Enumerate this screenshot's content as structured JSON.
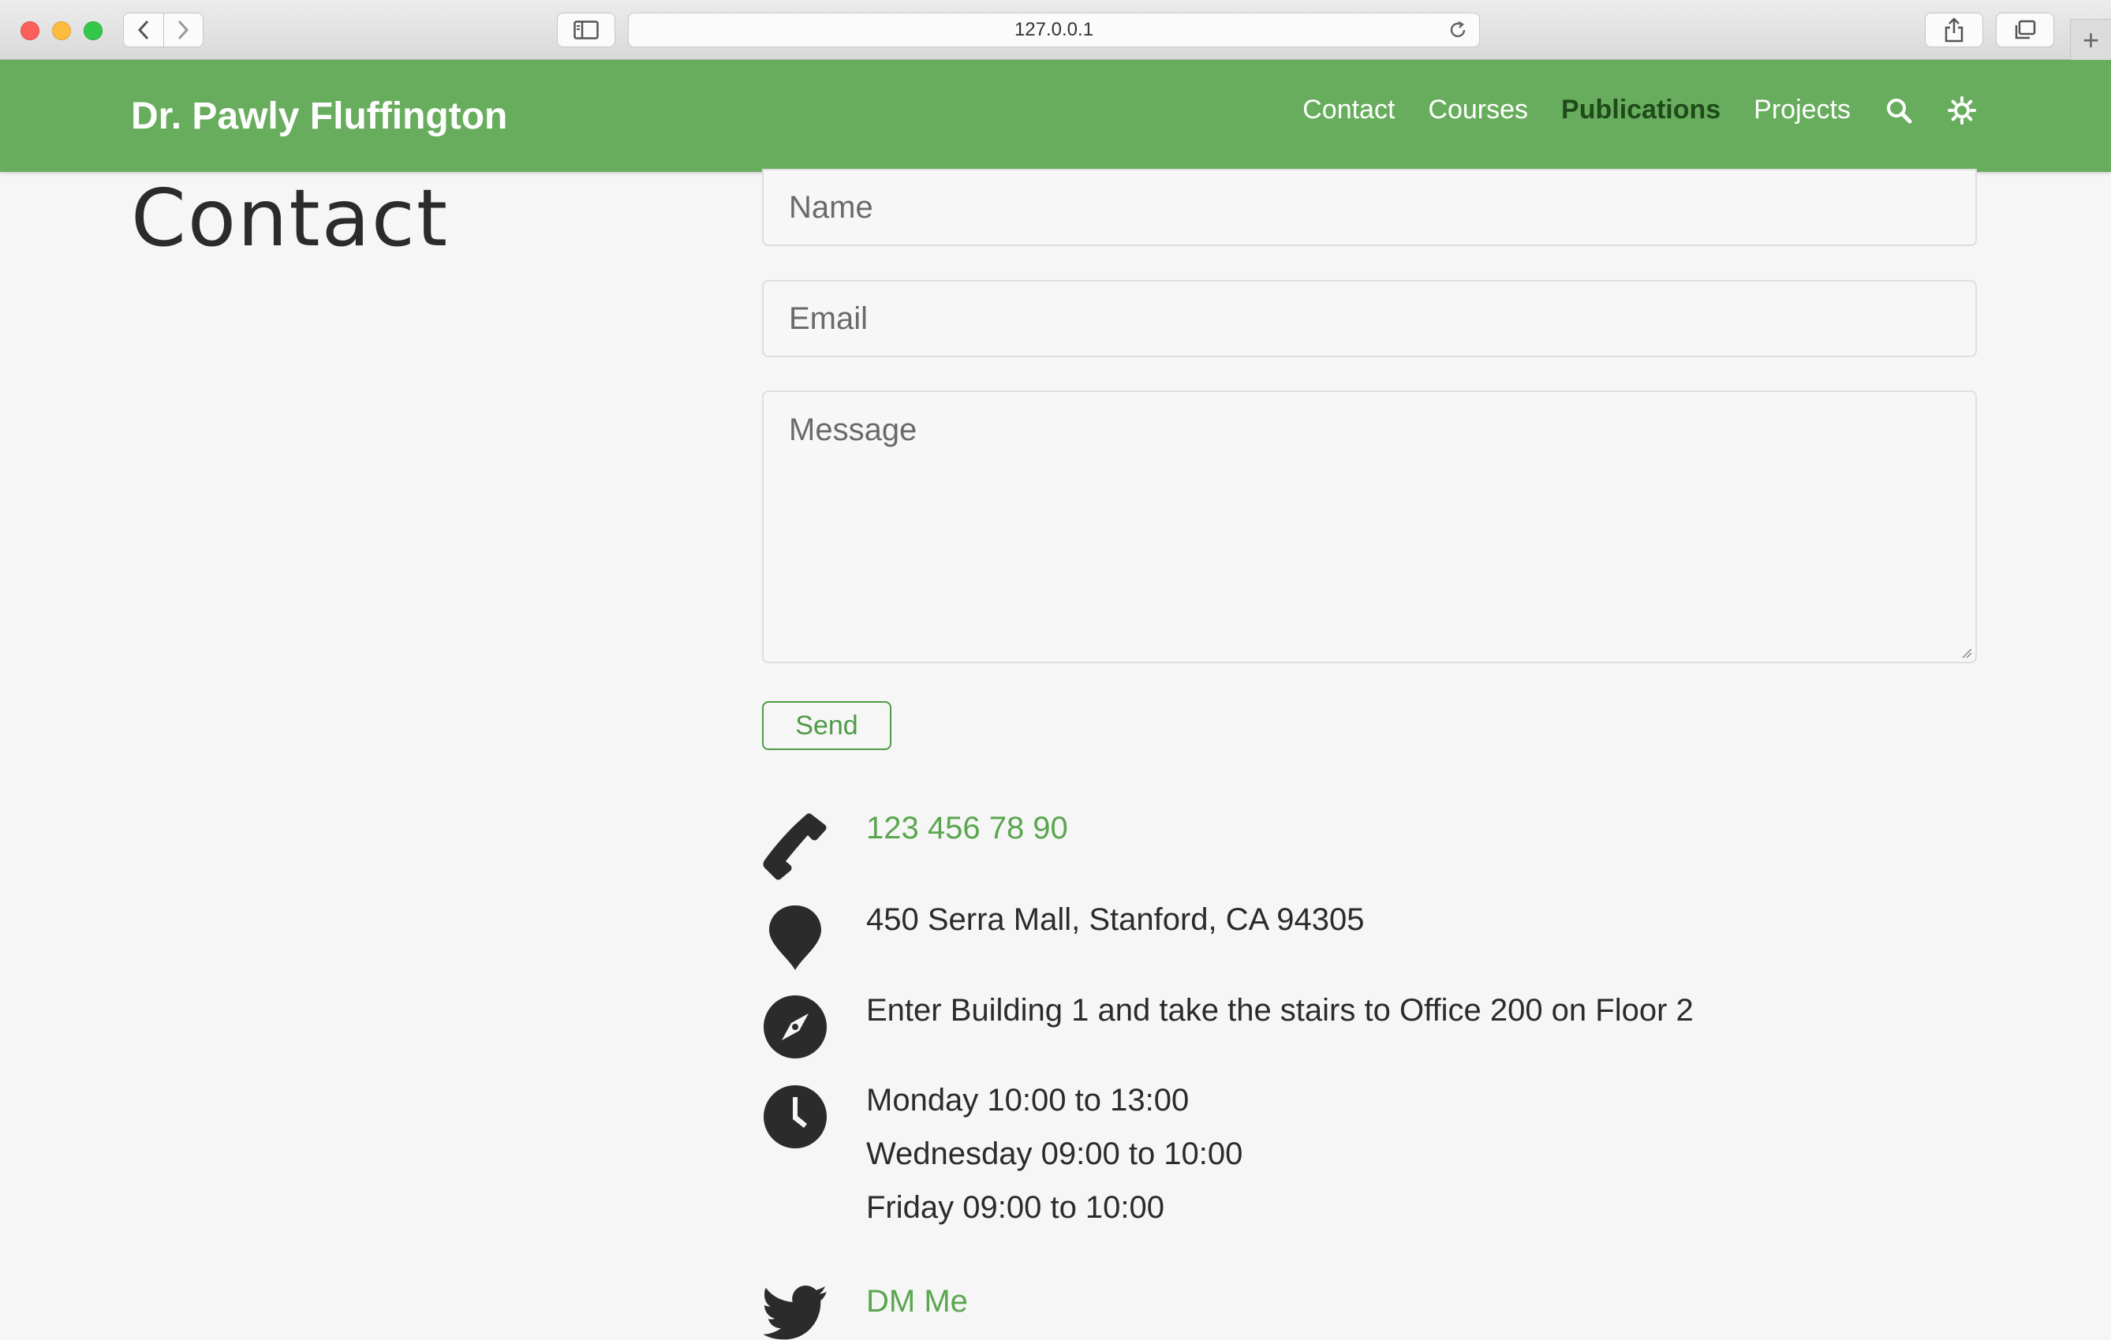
{
  "browser": {
    "url": "127.0.0.1"
  },
  "site": {
    "brand": "Dr. Pawly Fluffington",
    "nav": [
      {
        "label": "Contact",
        "active": false
      },
      {
        "label": "Courses",
        "active": false
      },
      {
        "label": "Publications",
        "active": true
      },
      {
        "label": "Projects",
        "active": false
      }
    ],
    "icons": [
      "search-icon",
      "theme-toggle-icon"
    ]
  },
  "page": {
    "title": "Contact"
  },
  "form": {
    "name_placeholder": "Name",
    "email_placeholder": "Email",
    "message_placeholder": "Message",
    "send_label": "Send"
  },
  "contact_info": {
    "phone": "123 456 78 90",
    "address": "450 Serra Mall, Stanford, CA 94305",
    "directions": "Enter Building 1 and take the stairs to Office 200 on Floor 2",
    "hours": [
      "Monday 10:00 to 13:00",
      "Wednesday 09:00 to 10:00",
      "Friday 09:00 to 10:00"
    ],
    "twitter": "DM Me"
  },
  "colors": {
    "navbar": "#68ad5d",
    "accent": "#5aa64f",
    "active_nav": "#1f4a1a"
  }
}
